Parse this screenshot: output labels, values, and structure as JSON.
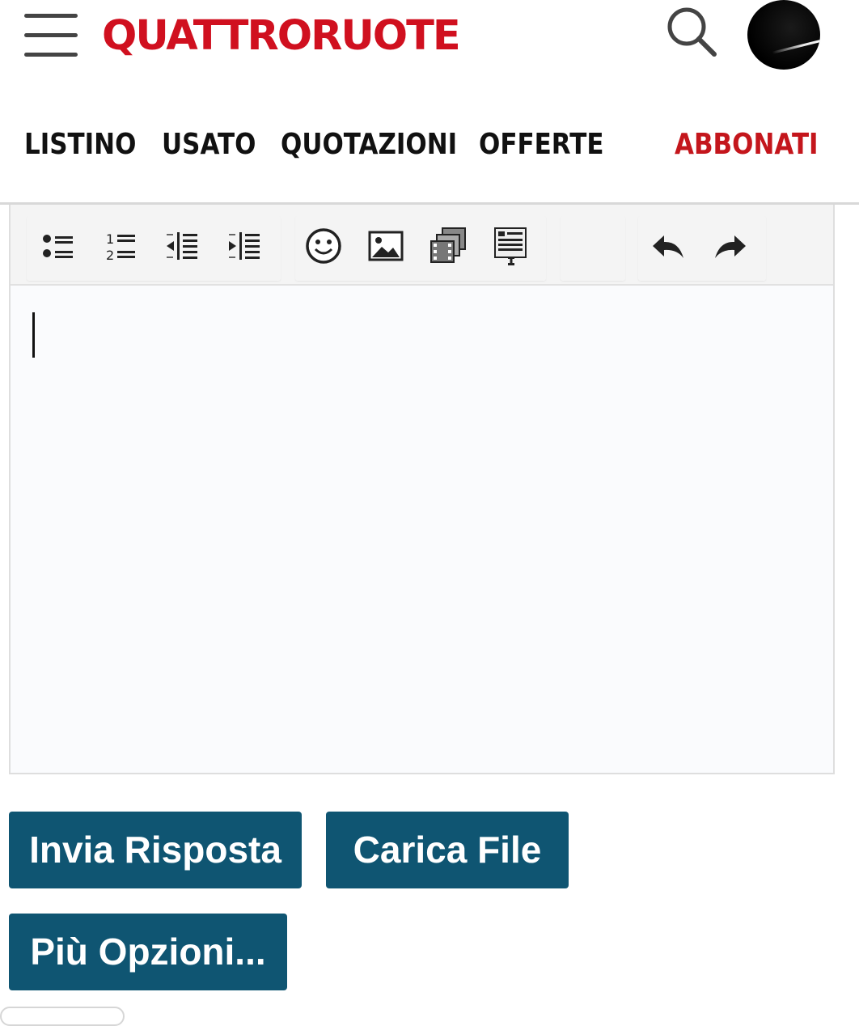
{
  "header": {
    "logo": "QUATTRORUOTE",
    "brand_color": "#d0101f"
  },
  "nav": {
    "items": [
      "LISTINO",
      "USATO",
      "QUOTAZIONI",
      "OFFERTE"
    ],
    "subscribe": "ABBONATI",
    "subscribe_color": "#c4161c"
  },
  "editor": {
    "toolbar_icons": [
      "bulleted-list-icon",
      "numbered-list-icon",
      "outdent-icon",
      "indent-icon",
      "smiley-icon",
      "image-icon",
      "media-icon",
      "template-icon",
      "undo-icon",
      "redo-icon"
    ],
    "content": ""
  },
  "actions": {
    "send_reply": "Invia Risposta",
    "upload_file": "Carica File",
    "more_options": "Più Opzioni...",
    "button_color": "#0f5572"
  }
}
